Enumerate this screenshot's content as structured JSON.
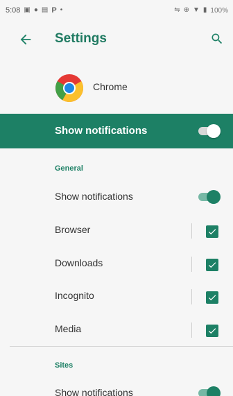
{
  "status_bar": {
    "time": "5:08",
    "battery": "100%"
  },
  "header": {
    "title": "Settings"
  },
  "app": {
    "name": "Chrome"
  },
  "master": {
    "label": "Show notifications",
    "enabled": true
  },
  "general": {
    "header": "General",
    "show_notifications": "Show notifications",
    "items": [
      {
        "label": "Browser",
        "checked": true
      },
      {
        "label": "Downloads",
        "checked": true
      },
      {
        "label": "Incognito",
        "checked": true
      },
      {
        "label": "Media",
        "checked": true
      }
    ]
  },
  "sites": {
    "header": "Sites",
    "show_notifications": "Show notifications"
  },
  "colors": {
    "accent": "#1d8065",
    "background": "#f6f6f6"
  }
}
